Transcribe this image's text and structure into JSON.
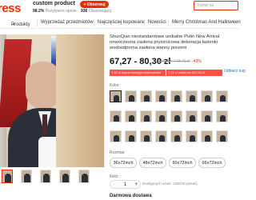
{
  "header": {
    "logo": "ress",
    "store_name": "custom product",
    "store_rating_value": "98.2%",
    "store_rating_label": "Pozytywne opinie",
    "follow_label": "+ Obserwuj",
    "followers_count": "936",
    "followers_label": "Obserwujący",
    "search_placeholder": "Konar za"
  },
  "nav": {
    "items": [
      {
        "label": "Produkty",
        "has_chevron": true
      },
      {
        "label": "Wyprzedaż przedmiotów",
        "has_chevron": false
      },
      {
        "label": "Najczęściej kupowane",
        "has_chevron": false
      },
      {
        "label": "Nowości",
        "has_chevron": false
      },
      {
        "label": "Merry Christmas And Halloween",
        "has_chevron": false
      }
    ]
  },
  "product": {
    "title": "ShunQian niestandardowe unikalne Putin New Arrival nowoczesna zasłona prysznicowa dekoracja łazienki wodoodporna zasłona wanny prezent",
    "price": "67,27 - 80,30 zł",
    "price_old": "119,25 - 143,41 zł",
    "discount": "-49%",
    "coupon1": "7,62 zł kupon nowego użytkownika",
    "coupon2": "7,79 zł zniżki na 247,63 zł",
    "more_coupons": "Odbierz kup",
    "color_label": "Kolor:",
    "size_label": "Rozmiar:",
    "sizes": [
      "36x72inch",
      "48x72inch",
      "60x72inch",
      "66x72inch"
    ],
    "quantity_label": "Ilość:",
    "quantity": "1",
    "stock_text": "Dostępnych sztuk: 100078 (sztuki)",
    "shipping_label": "Darmowa dostawa"
  },
  "colors": {
    "accent": "#e62e04",
    "coupon_bg": "#ff5242",
    "link": "#1a73e8"
  }
}
